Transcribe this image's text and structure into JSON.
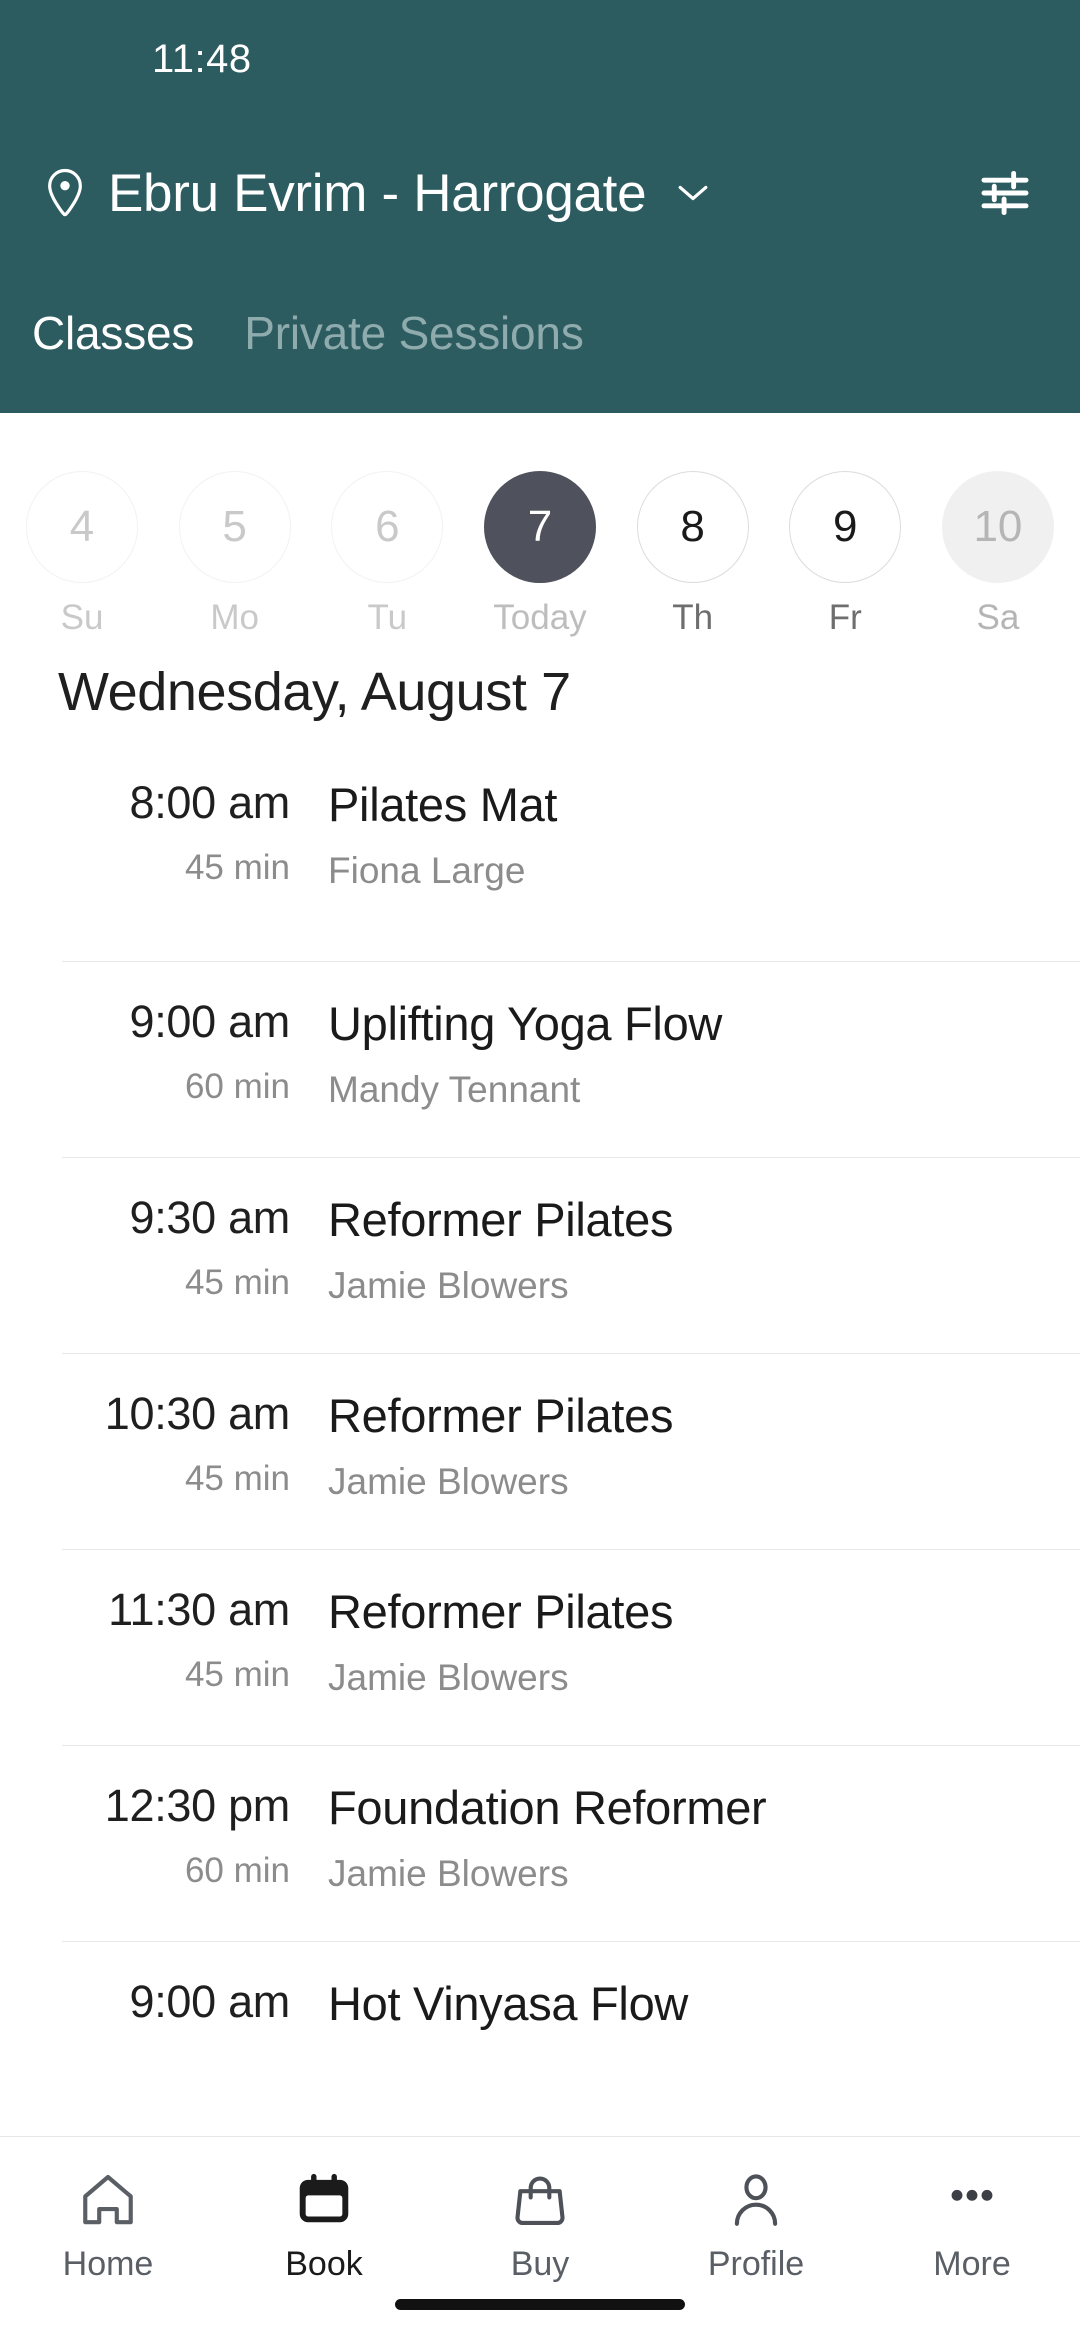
{
  "status_bar": {
    "clock": "11:48"
  },
  "header": {
    "accent_color": "#2c5c60",
    "location_icon": "location-pin-icon",
    "location_title": "Ebru Evrim - Harrogate",
    "dropdown_icon": "chevron-down-icon",
    "filter_icon": "filter-sliders-icon",
    "tabs": [
      {
        "label": "Classes",
        "active": true
      },
      {
        "label": "Private Sessions",
        "active": false
      }
    ]
  },
  "date_strip": {
    "selected_color": "#4f525c",
    "days": [
      {
        "number": "4",
        "weekday": "Su",
        "state": "past"
      },
      {
        "number": "5",
        "weekday": "Mo",
        "state": "past"
      },
      {
        "number": "6",
        "weekday": "Tu",
        "state": "past"
      },
      {
        "number": "7",
        "weekday": "Today",
        "state": "today"
      },
      {
        "number": "8",
        "weekday": "Th",
        "state": "future"
      },
      {
        "number": "9",
        "weekday": "Fr",
        "state": "future"
      },
      {
        "number": "10",
        "weekday": "Sa",
        "state": "disabled"
      }
    ]
  },
  "schedule": {
    "day_heading": "Wednesday, August 7",
    "classes": [
      {
        "time": "8:00 am",
        "duration": "45 min",
        "name": "Pilates Mat",
        "instructor": "Fiona Large"
      },
      {
        "time": "9:00 am",
        "duration": "60 min",
        "name": "Uplifting Yoga Flow",
        "instructor": "Mandy Tennant"
      },
      {
        "time": "9:30 am",
        "duration": "45 min",
        "name": "Reformer Pilates",
        "instructor": "Jamie Blowers"
      },
      {
        "time": "10:30 am",
        "duration": "45 min",
        "name": "Reformer Pilates",
        "instructor": "Jamie Blowers"
      },
      {
        "time": "11:30 am",
        "duration": "45 min",
        "name": "Reformer Pilates",
        "instructor": "Jamie Blowers"
      },
      {
        "time": "12:30 pm",
        "duration": "60 min",
        "name": "Foundation Reformer",
        "instructor": "Jamie Blowers"
      },
      {
        "time": "9:00 am",
        "duration": "",
        "name": "Hot Vinyasa Flow",
        "instructor": ""
      }
    ]
  },
  "bottom_nav": {
    "items": [
      {
        "label": "Home",
        "icon": "home-icon",
        "active": false
      },
      {
        "label": "Book",
        "icon": "calendar-icon",
        "active": true
      },
      {
        "label": "Buy",
        "icon": "shopping-bag-icon",
        "active": false
      },
      {
        "label": "Profile",
        "icon": "person-icon",
        "active": false
      },
      {
        "label": "More",
        "icon": "ellipsis-icon",
        "active": false
      }
    ]
  }
}
